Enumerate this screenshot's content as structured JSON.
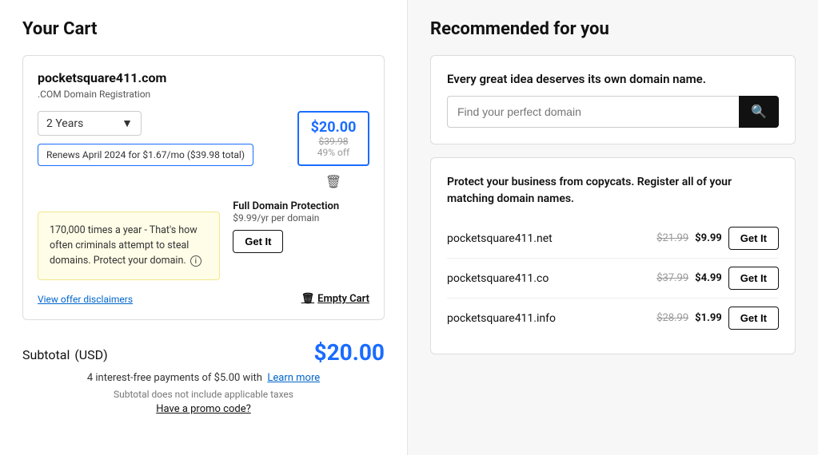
{
  "left": {
    "title": "Your Cart",
    "cart": {
      "domain": "pocketsquare411.com",
      "domain_type": ".COM Domain Registration",
      "years_select": "2 Years",
      "price": "$20.00",
      "price_old": "$39.98",
      "price_off": "49% off",
      "renew_notice": "Renews April 2024 for $1.67/mo ($39.98 total)",
      "promo_text": "170,000 times a year - That's how often criminals attempt to steal domains. Protect your domain.",
      "full_protection_label": "Full Domain Protection",
      "full_protection_price": "$9.99/yr per domain",
      "get_it_label": "Get It",
      "view_disclaimer": "View offer disclaimers",
      "empty_cart": "Empty Cart"
    },
    "subtotal": {
      "label": "Subtotal",
      "currency": "(USD)",
      "amount": "$20.00",
      "installment": "4 interest-free payments of $5.00 with",
      "learn_more": "Learn more",
      "tax_note": "Subtotal does not include applicable taxes",
      "promo_link": "Have a promo code?"
    }
  },
  "right": {
    "title": "Recommended for you",
    "search_card": {
      "tagline": "Every great idea deserves its own domain name.",
      "search_placeholder": "Find your perfect domain"
    },
    "protect_card": {
      "tagline": "Protect your business from copycats. Register all of your matching domain names.",
      "offers": [
        {
          "domain": "pocketsquare411.net",
          "old_price": "$21.99",
          "new_price": "$9.99",
          "btn": "Get It"
        },
        {
          "domain": "pocketsquare411.co",
          "old_price": "$37.99",
          "new_price": "$4.99",
          "btn": "Get It"
        },
        {
          "domain": "pocketsquare411.info",
          "old_price": "$28.99",
          "new_price": "$1.99",
          "btn": "Get It"
        }
      ]
    }
  }
}
